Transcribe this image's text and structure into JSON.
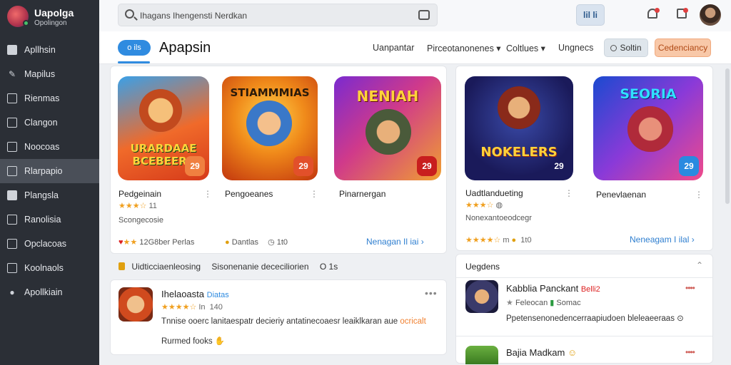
{
  "brand": {
    "name": "Uapolga",
    "subtitle": "Opolingon"
  },
  "sidebar": {
    "items": [
      {
        "label": "Apllhsin",
        "icon": "grid-icon"
      },
      {
        "label": "Mapilus",
        "icon": "wrench-icon"
      },
      {
        "label": "Rienmas",
        "icon": "chat-icon"
      },
      {
        "label": "Clangon",
        "icon": "calendar-icon"
      },
      {
        "label": "Noocoas",
        "icon": "image-icon"
      },
      {
        "label": "Rlarpapio",
        "icon": "folder-icon"
      },
      {
        "label": "Plangsla",
        "icon": "card-icon"
      },
      {
        "label": "Ranolisia",
        "icon": "chart-icon"
      },
      {
        "label": "Opclacoas",
        "icon": "play-icon"
      },
      {
        "label": "Koolnaols",
        "icon": "bookmark-icon"
      },
      {
        "label": "Apollkiain",
        "icon": "location-icon"
      }
    ],
    "active_index": 5
  },
  "search": {
    "placeholder": "Ihagans Ihengensti Nerdkan"
  },
  "topbar": {
    "button_label": "lil li"
  },
  "header": {
    "pill": "o ils",
    "title": "Apapsin",
    "tabs": [
      "Uanpantar",
      "Pirceotanonenes",
      "Coltlues",
      "Ungnecs"
    ],
    "button_soft": "Soltin",
    "button_primary": "Cedenciancy"
  },
  "featured_left": {
    "games": [
      {
        "name": "Pedgeinain",
        "rating": "★★★☆",
        "rating_count": "11",
        "art_title": "URARDAAE BCEBEERS",
        "badge": "29"
      },
      {
        "name": "Pengoeanes",
        "art_title": "STIAMMMIAS",
        "badge": "29"
      },
      {
        "name": "Pinarnergan",
        "art_title": "NENIAH",
        "badge": "29"
      }
    ],
    "sub_label": "Scongecosie",
    "footer_left": "12G8ber Perlas",
    "footer_mid": "Dantlas",
    "footer_mid2": "1t0",
    "link": "Nenagan Il iai"
  },
  "featured_right": {
    "games": [
      {
        "name": "Uadtlandueting",
        "rating": "★★★☆",
        "rating_count": "",
        "art_title": "NOKELERS",
        "badge": "29"
      },
      {
        "name": "Penevlaenan",
        "art_title": "SEORIA",
        "badge": "29"
      }
    ],
    "sub_label": "Nonexantoeodcegr",
    "footer_rating": "★★★★☆",
    "footer_rating_n": "m",
    "footer_count": "1t0",
    "link": "Neneagam I ilal"
  },
  "filter_bar": {
    "label1": "Uidticciaenleosing",
    "label2": "Sisonenanie dececiliorien",
    "label3": "O 1s"
  },
  "review": {
    "name": "Ihelaoasta",
    "tag": "Diatas",
    "stars": "★★★★☆",
    "meta1": "In",
    "meta2": "140",
    "text": "Tnnise ooerc lanitaespatr decieriy antatinecoaesr leaiklkaran aue",
    "text_highlight": "ocricalt",
    "more": "Rurmed fooks"
  },
  "side_list": {
    "title": "Uegdens",
    "items": [
      {
        "title": "Kabblia Panckant",
        "tag": "Belli2",
        "sub": "Feleocan",
        "sub2": "Somac",
        "desc": "Ppetensenonedencerraapiudoen bleleaeeraas"
      },
      {
        "title": "Bajia Madkam",
        "tag": "",
        "sub": "",
        "sub2": "",
        "desc": ""
      }
    ]
  },
  "colors": {
    "accent": "#2f8be0",
    "orange": "#f08040",
    "sidebar_bg": "#2b2f36"
  }
}
